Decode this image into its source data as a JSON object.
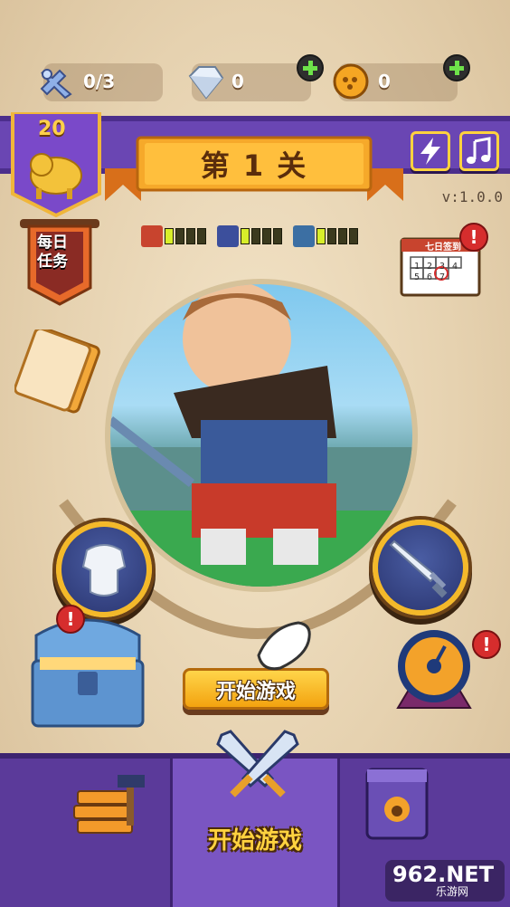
{
  "resources": {
    "keys": {
      "value": "0/3",
      "icon": "key-icon"
    },
    "diamonds": {
      "value": "0",
      "icon": "diamond-icon"
    },
    "coins": {
      "value": "0",
      "icon": "coin-icon"
    }
  },
  "player": {
    "level": "20",
    "icon": "golden-pig-icon"
  },
  "stage": {
    "title": "第 1 关"
  },
  "settings": {
    "power_icon": "lightning-icon",
    "music_icon": "music-note-icon"
  },
  "version": "v:1.0.0",
  "daily_task": {
    "label": "每日任务"
  },
  "stats": [
    {
      "icon": "health-icon",
      "filled": 1,
      "total": 5
    },
    {
      "icon": "speed-icon",
      "filled": 1,
      "total": 5
    },
    {
      "icon": "armor-icon",
      "filled": 1,
      "total": 5
    }
  ],
  "seven_day": {
    "title": "七日签到",
    "cells": [
      "1",
      "2",
      "3",
      "4",
      "5",
      "6",
      "7"
    ]
  },
  "buttons": {
    "armor_icon": "armor-icon",
    "sword_icon": "sword-icon",
    "chest_icon": "treasure-chest-icon",
    "wheel_icon": "prize-wheel-icon",
    "tickets_icon": "ticket-icon",
    "start_label": "开始游戏"
  },
  "nav": {
    "left_icon": "forge-icon",
    "mid_label": "开始游戏",
    "mid_icon": "crossed-swords-icon",
    "right_icon": "pet-book-icon"
  },
  "watermark": {
    "big": "962.NET",
    "small": "乐游网"
  },
  "colors": {
    "band_purple": "#6a46b3",
    "ribbon_orange": "#f6a92a",
    "accent_gold": "#ffd23f",
    "alert_red": "#d62d2d"
  }
}
